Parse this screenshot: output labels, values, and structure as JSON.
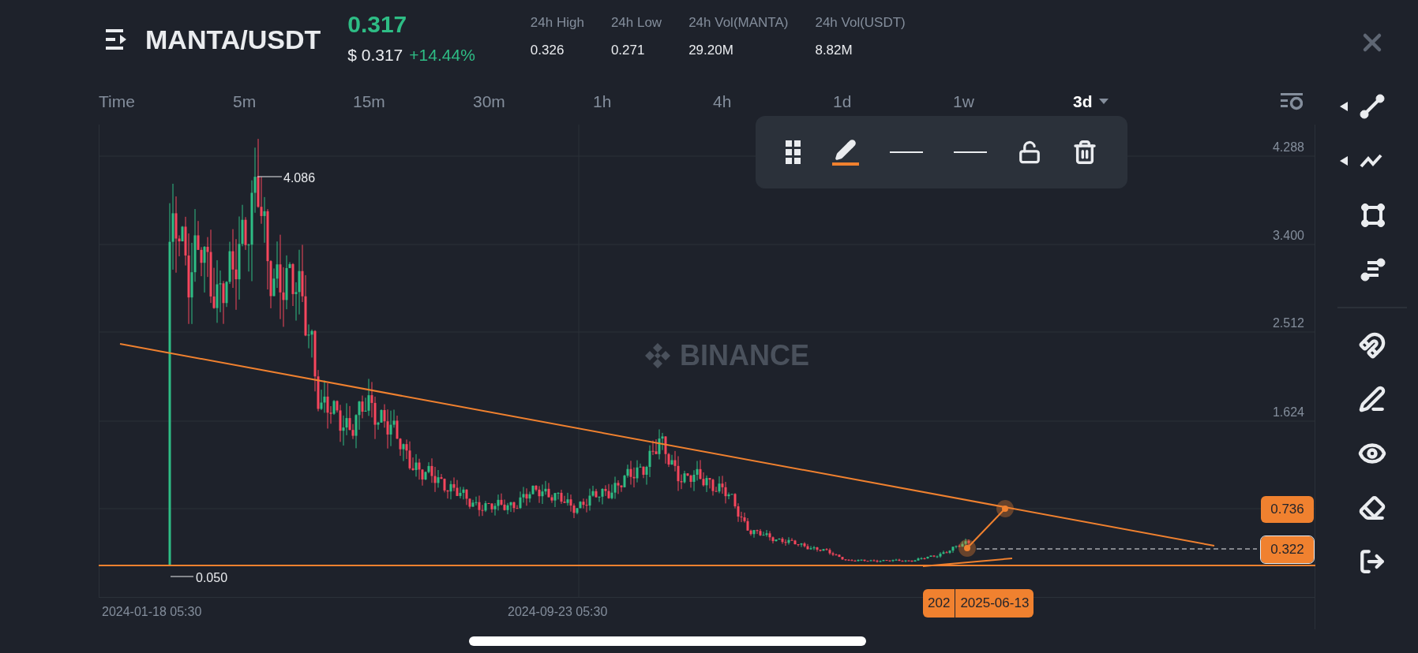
{
  "header": {
    "symbol": "MANTA/USDT",
    "price": "0.317",
    "usd_price": "$ 0.317",
    "change": "+14.44%",
    "stats": [
      {
        "label": "24h High",
        "value": "0.326"
      },
      {
        "label": "24h Low",
        "value": "0.271"
      },
      {
        "label": "24h Vol(MANTA)",
        "value": "29.20M"
      },
      {
        "label": "24h Vol(USDT)",
        "value": "8.82M"
      }
    ]
  },
  "interval_label": "Time",
  "intervals": [
    {
      "label": "5m",
      "selected": false
    },
    {
      "label": "15m",
      "selected": false
    },
    {
      "label": "30m",
      "selected": false
    },
    {
      "label": "1h",
      "selected": false
    },
    {
      "label": "4h",
      "selected": false
    },
    {
      "label": "1d",
      "selected": false
    },
    {
      "label": "1w",
      "selected": false
    },
    {
      "label": "3d",
      "selected": true
    }
  ],
  "chart": {
    "watermark": "BINANCE",
    "price_axis": [
      "4.288",
      "3.400",
      "2.512",
      "1.624"
    ],
    "high_marker": "4.086",
    "low_marker": "0.050",
    "time_axis": [
      "2024-01-18 05:30",
      "2024-09-23 05:30"
    ],
    "price_tags": [
      "0.736",
      "0.322"
    ],
    "time_tags": [
      "202",
      "2025-06-13"
    ]
  }
}
